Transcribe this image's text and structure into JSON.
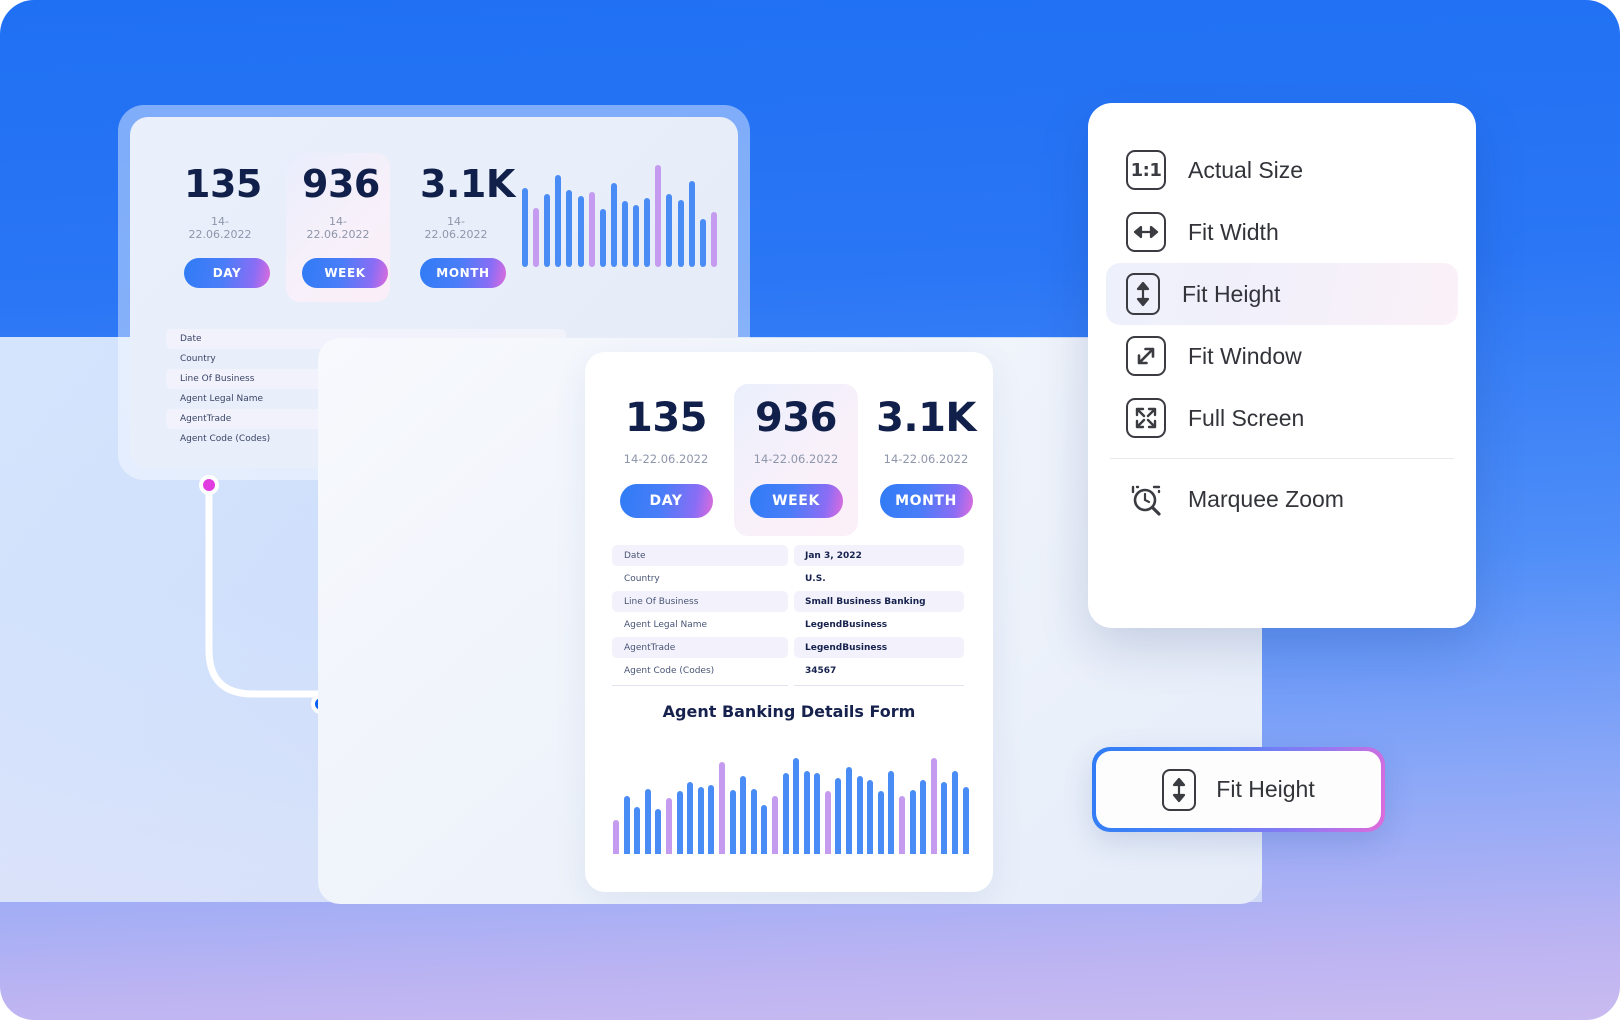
{
  "background": {
    "gradient_from": "#2070f4",
    "gradient_to": "#c9bbf0"
  },
  "back_card": {
    "metrics": [
      {
        "value": "135",
        "date": "14-22.06.2022",
        "button": "DAY",
        "highlighted": false
      },
      {
        "value": "936",
        "date": "14-22.06.2022",
        "button": "WEEK",
        "highlighted": true
      },
      {
        "value": "3.1K",
        "date": "14-22.06.2022",
        "button": "MONTH",
        "highlighted": false
      }
    ],
    "table_rows": [
      "Date",
      "Country",
      "Line Of Business",
      "Agent Legal Name",
      "AgentTrade",
      "Agent Code (Codes)"
    ]
  },
  "front_card": {
    "metrics": [
      {
        "value": "135",
        "date": "14-22.06.2022",
        "button": "DAY",
        "highlighted": false
      },
      {
        "value": "936",
        "date": "14-22.06.2022",
        "button": "WEEK",
        "highlighted": true
      },
      {
        "value": "3.1K",
        "date": "14-22.06.2022",
        "button": "MONTH",
        "highlighted": false
      }
    ],
    "details": [
      {
        "key": "Date",
        "value": "Jan 3, 2022"
      },
      {
        "key": "Country",
        "value": "U.S."
      },
      {
        "key": "Line Of Business",
        "value": "Small Business Banking"
      },
      {
        "key": "Agent Legal Name",
        "value": "LegendBusiness"
      },
      {
        "key": "AgentTrade",
        "value": "LegendBusiness"
      },
      {
        "key": "Agent Code (Codes)",
        "value": "34567"
      }
    ],
    "form_title": "Agent Banking Details Form"
  },
  "menu": {
    "items": [
      {
        "label": "Actual Size",
        "icon": "actual-size-icon",
        "active": false,
        "separator_after": false
      },
      {
        "label": "Fit Width",
        "icon": "fit-width-icon",
        "active": false,
        "separator_after": false
      },
      {
        "label": "Fit Height",
        "icon": "fit-height-icon",
        "active": true,
        "separator_after": false
      },
      {
        "label": "Fit Window",
        "icon": "fit-window-icon",
        "active": false,
        "separator_after": false
      },
      {
        "label": "Full Screen",
        "icon": "full-screen-icon",
        "active": false,
        "separator_after": true
      },
      {
        "label": "Marquee Zoom",
        "icon": "marquee-zoom-icon",
        "active": false,
        "separator_after": false
      }
    ],
    "actual_size_glyph": "1:1"
  },
  "floating_button": {
    "label": "Fit Height",
    "icon": "fit-height-icon",
    "border_gradient_from": "#2f7cf6",
    "border_gradient_to": "#e06bdb"
  },
  "connector": {
    "start_dot_color": "#e03ce0",
    "end_dot_color": "#0a5ef0"
  },
  "chart_data": [
    {
      "type": "bar",
      "title": "",
      "id": "back-card-mini-chart",
      "categories": [
        "1",
        "2",
        "3",
        "4",
        "5",
        "6",
        "7",
        "8",
        "9",
        "10",
        "11",
        "12",
        "13",
        "14",
        "15",
        "16",
        "17",
        "18"
      ],
      "values": [
        72,
        54,
        66,
        84,
        70,
        65,
        68,
        53,
        76,
        60,
        56,
        63,
        93,
        66,
        61,
        78,
        44,
        50
      ],
      "colors": [
        "#4a8cf5",
        "#c59bf0",
        "#4a8cf5",
        "#4a8cf5",
        "#4a8cf5",
        "#4a8cf5",
        "#c59bf0",
        "#4a8cf5",
        "#4a8cf5",
        "#4a8cf5",
        "#4a8cf5",
        "#4a8cf5",
        "#c59bf0",
        "#4a8cf5",
        "#4a8cf5",
        "#4a8cf5",
        "#4a8cf5",
        "#c59bf0"
      ],
      "ylim": [
        0,
        100
      ],
      "xlabel": "",
      "ylabel": "",
      "grid": false,
      "legend": "none"
    },
    {
      "type": "bar",
      "title": "Agent Banking Details Form",
      "id": "front-card-chart",
      "categories": [
        "1",
        "2",
        "3",
        "4",
        "5",
        "6",
        "7",
        "8",
        "9",
        "10",
        "11",
        "12",
        "13",
        "14",
        "15",
        "16",
        "17",
        "18",
        "19",
        "20",
        "21",
        "22",
        "23",
        "24",
        "25",
        "26",
        "27",
        "28",
        "29",
        "30",
        "31",
        "32",
        "33",
        "34"
      ],
      "values": [
        30,
        52,
        42,
        58,
        40,
        50,
        56,
        64,
        60,
        62,
        82,
        57,
        70,
        58,
        44,
        52,
        72,
        86,
        74,
        72,
        56,
        68,
        78,
        70,
        66,
        56,
        74,
        52,
        57,
        66,
        86,
        64,
        74,
        60
      ],
      "colors": [
        "#c59bf0",
        "#4a8cf5",
        "#4a8cf5",
        "#4a8cf5",
        "#4a8cf5",
        "#c59bf0",
        "#4a8cf5",
        "#4a8cf5",
        "#4a8cf5",
        "#4a8cf5",
        "#c59bf0",
        "#4a8cf5",
        "#4a8cf5",
        "#4a8cf5",
        "#4a8cf5",
        "#c59bf0",
        "#4a8cf5",
        "#4a8cf5",
        "#4a8cf5",
        "#4a8cf5",
        "#c59bf0",
        "#4a8cf5",
        "#4a8cf5",
        "#4a8cf5",
        "#4a8cf5",
        "#4a8cf5",
        "#4a8cf5",
        "#c59bf0",
        "#4a8cf5",
        "#4a8cf5",
        "#c59bf0",
        "#4a8cf5",
        "#4a8cf5",
        "#4a8cf5"
      ],
      "ylim": [
        0,
        100
      ],
      "xlabel": "",
      "ylabel": "",
      "grid": false,
      "legend": "none"
    }
  ]
}
